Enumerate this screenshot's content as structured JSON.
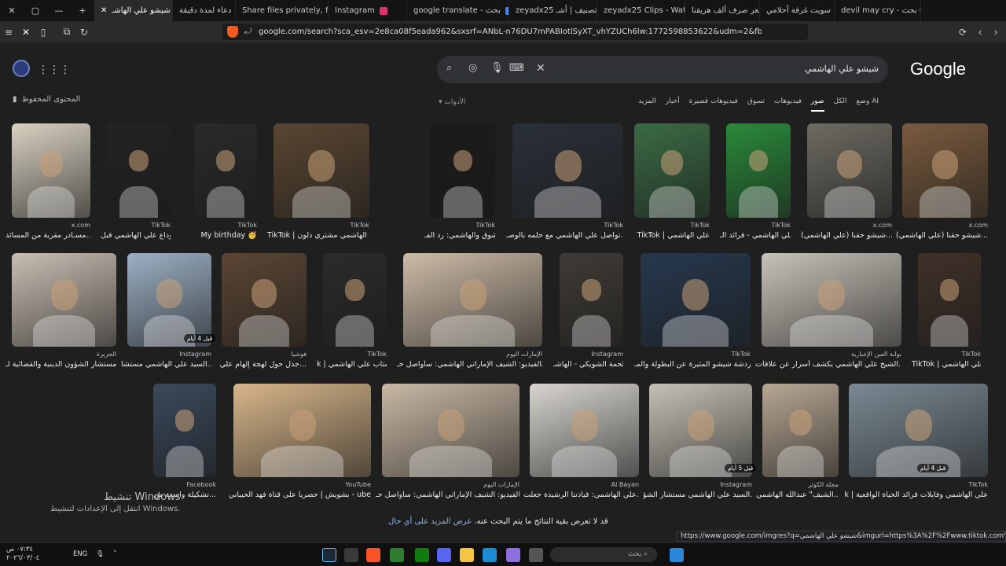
{
  "browser": {
    "tabs": [
      {
        "label": "شيشو علي الهاشـ",
        "fav": "#4285f4",
        "active": true,
        "w": 100
      },
      {
        "label": "دعاء لمدة دقيقة",
        "fav": "#b0b0b0",
        "w": 80
      },
      {
        "label": "Share files privately, fast",
        "fav": "#d0d0d0",
        "w": 118
      },
      {
        "label": "Instagram",
        "fav": "#e1306c",
        "w": 100
      },
      {
        "label": "google translate - بحث",
        "fav": "#4285f4",
        "w": 130
      },
      {
        "label": "zeyadx25 تصنيف | أشـ",
        "fav": "#ffffff",
        "w": 112
      },
      {
        "label": "zeyadx25 Clips - Watch",
        "fav": "#53fc18",
        "w": 112
      },
      {
        "label": "سعر صرف ألف هريقنا",
        "fav": "#6bbf3a",
        "w": 95
      },
      {
        "label": "سويت غرفة أحلامي",
        "fav": "#ff0000",
        "w": 95
      },
      {
        "label": "devil may cry - بحث Go",
        "fav": "#4285f4",
        "w": 110
      }
    ],
    "url": "google.com/search?sca_esv=2e8ca08f5eada962&sxsrf=ANbL-n76DU7mPABIotlSyXT_vhYZUCh6lw:1772598853622&udm=2&fbs=ADc_l-ZjmiS7ti7q3ZmZM...",
    "new_tab": "+"
  },
  "google": {
    "logo": "Google",
    "query": "شيشو علي الهاشمي",
    "saved_label": "المحتوى المحفوظ",
    "tabs": [
      "وضع AI",
      "الكل",
      "صور",
      "فيديوهات",
      "تسوق",
      "فيديوهات قصيرة",
      "أخبار",
      "المزيد"
    ],
    "active_tab": "صور",
    "tools": "الأدوات",
    "more_text": "قد لا تعرض بقية النتائج ما يتم البحث عنه.",
    "more_link": "عرض المزيد على أي حال"
  },
  "results_row1": [
    {
      "src": "x.com",
      "title": "شيشو حقنا (علي الهاشمي)...",
      "color": "#7a5b3e"
    },
    {
      "src": "x.com",
      "title": "شيشو حقنا (علي الهاشمي)...",
      "color": "#6d6a62"
    },
    {
      "src": "TikTok",
      "title": "علي الهاشمي - قرائد الـ...",
      "color": "#2a8a3a"
    },
    {
      "src": "TikTok",
      "title": "TikTok | علي الهاشمي",
      "color": "#3b6b45"
    },
    {
      "src": "TikTok",
      "title": "تواصل علي الهاشمي مع حلمه بالوصـ...",
      "color": "#2a3038"
    },
    {
      "src": "TikTok",
      "title": "شوق والهاشمي: رد الفـ...",
      "color": "#1b1b1b"
    },
    {
      "src": "TikTok",
      "title": "TikTok | علي الهاشمي مشتري ذلون",
      "color": "#5a4632"
    },
    {
      "src": "TikTok",
      "title": "My birthday 🥳",
      "color": "#2a2a2a"
    },
    {
      "src": "TikTok",
      "title": "وداع علي الهاشمي قبل...",
      "color": "#232323"
    },
    {
      "src": "x.com",
      "title": "مسـادر مقربة من المسائد...",
      "color": "#d9d2c2"
    }
  ],
  "results_row2": [
    {
      "src": "TikTok",
      "title": "TikTok | علي الهاشمي",
      "color": "#403129"
    },
    {
      "src": "بوابة العين الإخبارية",
      "title": "الشيخ علي الهاشمي يكشف أسرار عن علاقات...",
      "color": "#c7c2b9"
    },
    {
      "src": "TikTok",
      "title": "دردشة شيشو المثيرة عن البطولة والمـ...",
      "color": "#26384e"
    },
    {
      "src": "Instagram",
      "title": "ملحمة الشويكي - الهاشـ...",
      "color": "#3f3b36"
    },
    {
      "src": "الإمارات اليوم",
      "title": "بالفيديو: الشيف الإماراتي الهاشمي: سأواصل حـ...",
      "color": "#cdbba7"
    },
    {
      "src": "TikTok",
      "title": "k | ستاب علي الهاشمي",
      "color": "#2b2b2b"
    },
    {
      "src": "فوشيا",
      "title": "جدل حول لهجة إلهام علي...",
      "color": "#5b4634"
    },
    {
      "src": "Instagram",
      "title": "السيد علي الهاشمي مستشا...",
      "color": "#9cb0c4"
    },
    {
      "src": "الجزيرة",
      "title": "مستشار الشؤون الدينية والقضائية لـ...",
      "color": "#c9bfb3"
    }
  ],
  "results_row3": [
    {
      "src": "TikTok",
      "title": "k | علي الهاشمي وفايلات قرائد الحياة الواقعية",
      "color": "#7b8a94"
    },
    {
      "src": "مجلة الكوثر",
      "title": "الشيف\" عبدالله الهاشمي...",
      "color": "#b8a894"
    },
    {
      "src": "Instagram",
      "title": "السيد علي الهاشمي مستشار الشؤ...",
      "color": "#c6c1b6"
    },
    {
      "src": "Al Bayan",
      "title": "علي الهاشمي: قيادتنا الرشيدة جعلت...",
      "color": "#d8d5cf"
    },
    {
      "src": "الإمارات اليوم",
      "title": "بالفيديو: الشيف الإماراتي الهاشمي: سأواصل حـ...",
      "color": "#c9b9a5"
    },
    {
      "src": "YouTube",
      "title": "بشويش | حصريا على قناة فهد الحيباني - ube",
      "color": "#d8b68a"
    },
    {
      "src": "Facebook",
      "title": "تشكيلة واسعة من...",
      "color": "#3b4a5c"
    }
  ],
  "badges": {
    "b1": "قبل 5 أيام",
    "b2": "قبل 4 أيام",
    "b3": "قبل 4 أيام"
  },
  "watermark": {
    "line1": "تنشيط Windows",
    "line2": "انتقل إلى الإعدادات لتنشيط Windows."
  },
  "status_url": "https://www.google.com/imgres?q=شيشو علي الهاشمي&imgurl=https%3A%2F%2Fwww.tiktok.com%2Fapi%2Fimg%...",
  "taskbar": {
    "search_placeholder": "بحث",
    "lang": "ENG",
    "clock": "٠٧:٣٤ ص",
    "date": "٢٠٢٦/٠٣/٠٤"
  }
}
